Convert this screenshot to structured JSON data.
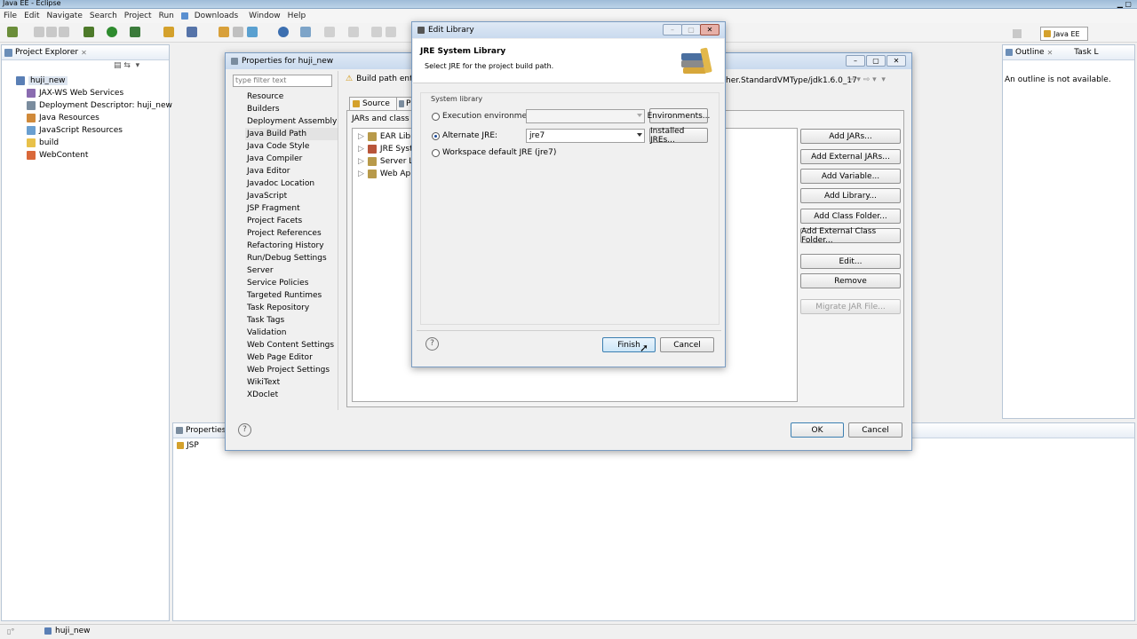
{
  "window": {
    "title": "Java EE - Eclipse"
  },
  "menu": [
    {
      "label": "File",
      "disabled": false
    },
    {
      "label": "Edit",
      "disabled": false
    },
    {
      "label": "Navigate",
      "disabled": false
    },
    {
      "label": "Search",
      "disabled": false
    },
    {
      "label": "Project",
      "disabled": false
    },
    {
      "label": "Run",
      "disabled": false
    },
    {
      "label": "Downloads",
      "disabled": false
    },
    {
      "label": "Window",
      "disabled": false
    },
    {
      "label": "Help",
      "disabled": false
    }
  ],
  "perspective": {
    "label": "Java EE"
  },
  "project_explorer": {
    "tab_label": "Project Explorer",
    "root": "huji_new",
    "items": [
      "JAX-WS Web Services",
      "Deployment Descriptor: huji_new",
      "Java Resources",
      "JavaScript Resources",
      "build",
      "WebContent"
    ]
  },
  "outline": {
    "tab_label": "Outline",
    "task_tab": "Task L",
    "message": "An outline is not available."
  },
  "properties_view": {
    "tab_label": "Properties",
    "item": "JSP"
  },
  "properties_dialog": {
    "title": "Properties for huji_new",
    "filter_placeholder": "type filter text",
    "nav_items": [
      "Resource",
      "Builders",
      "Deployment Assembly",
      "Java Build Path",
      "Java Code Style",
      "Java Compiler",
      "Java Editor",
      "Javadoc Location",
      "JavaScript",
      "JSP Fragment",
      "Project Facets",
      "Project References",
      "Refactoring History",
      "Run/Debug Settings",
      "Server",
      "Service Policies",
      "Targeted Runtimes",
      "Task Repository",
      "Task Tags",
      "Validation",
      "Web Content Settings",
      "Web Page Editor",
      "Web Project Settings",
      "WikiText",
      "XDoclet"
    ],
    "selected_nav": "Java Build Path",
    "warning_text": "Build path entry",
    "path_text": "her.StandardVMType/jdk1.6.0_17",
    "tab_source": "Source",
    "tab_projects": "P",
    "jars_label": "JARs and class fo",
    "libraries": [
      "EAR Libra",
      "JRE Syste",
      "Server Lib",
      "Web App"
    ],
    "buttons": [
      "Add JARs...",
      "Add External JARs...",
      "Add Variable...",
      "Add Library...",
      "Add Class Folder...",
      "Add External Class Folder...",
      "Edit...",
      "Remove",
      "Migrate JAR File..."
    ],
    "ok": "OK",
    "cancel": "Cancel"
  },
  "edit_library": {
    "title": "Edit Library",
    "heading": "JRE System Library",
    "description": "Select JRE for the project build path.",
    "group_label": "System library",
    "opt_env": "Execution environment:",
    "opt_alt": "Alternate JRE:",
    "opt_default": "Workspace default JRE (jre7)",
    "alt_value": "jre7",
    "btn_envs": "Environments...",
    "btn_installed": "Installed JREs...",
    "finish": "Finish",
    "cancel": "Cancel"
  },
  "status": {
    "text": "huji_new"
  }
}
